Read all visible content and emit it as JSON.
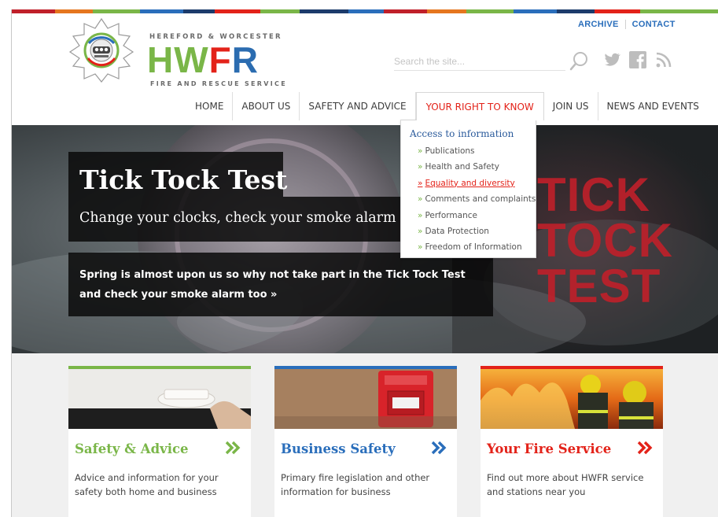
{
  "header": {
    "logo_top": "HEREFORD & WORCESTER",
    "logo_letters": [
      "HW",
      "F",
      "R"
    ],
    "logo_bottom": "FIRE AND RESCUE SERVICE",
    "archive_label": "ARCHIVE",
    "contact_label": "CONTACT",
    "search_placeholder": "Search the site...",
    "icons": [
      "search-icon",
      "twitter-icon",
      "facebook-icon",
      "rss-icon"
    ]
  },
  "nav": {
    "items": [
      {
        "label": "HOME"
      },
      {
        "label": "ABOUT US"
      },
      {
        "label": "SAFETY AND ADVICE"
      },
      {
        "label": "YOUR RIGHT TO KNOW"
      },
      {
        "label": "JOIN US"
      },
      {
        "label": "NEWS AND EVENTS"
      }
    ]
  },
  "dropdown": {
    "heading": "Access to information",
    "items": [
      {
        "label": "Publications"
      },
      {
        "label": "Health and Safety"
      },
      {
        "label": "Equality and diversity"
      },
      {
        "label": "Comments and complaints"
      },
      {
        "label": "Performance"
      },
      {
        "label": "Data Protection"
      },
      {
        "label": "Freedom of Information"
      }
    ]
  },
  "hero": {
    "title": "Tick Tock Test",
    "subtitle": "Change your clocks, check your smoke alarm",
    "cta": "Spring is almost upon us so why not take part in the Tick Tock Test and check your smoke alarm too »",
    "big_text": "TICK\nTOCK\nTEST"
  },
  "cards": [
    {
      "title": "Safety & Advice",
      "description": "Advice and information for your safety both home and business",
      "accent": "#7ab648"
    },
    {
      "title": "Business Safety",
      "description": "Primary fire legislation and other information for business",
      "accent": "#2a6ebb"
    },
    {
      "title": "Your Fire Service",
      "description": "Find out more about HWFR service and stations near you",
      "accent": "#e32219"
    }
  ],
  "colors": {
    "green": "#7ab648",
    "blue": "#2a6ebb",
    "red": "#e32219",
    "dark_red": "#c0202a"
  }
}
